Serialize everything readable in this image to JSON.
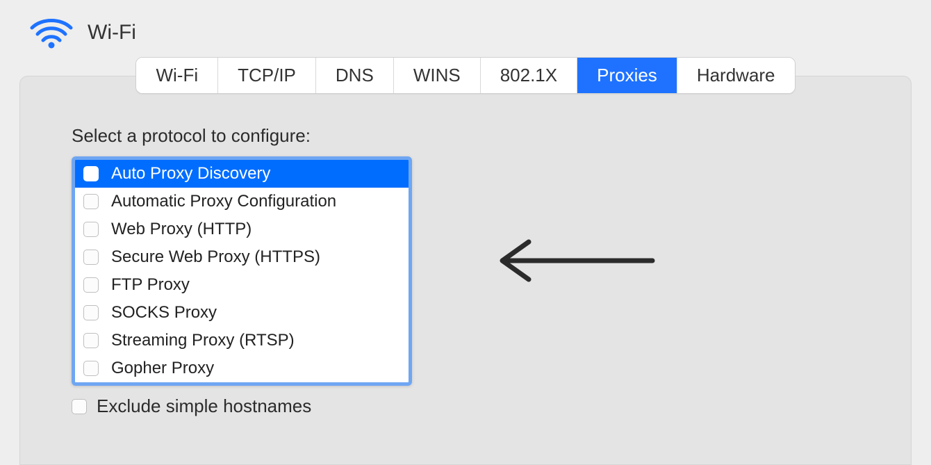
{
  "header": {
    "interface_name": "Wi-Fi"
  },
  "tabs": [
    {
      "label": "Wi-Fi",
      "active": false
    },
    {
      "label": "TCP/IP",
      "active": false
    },
    {
      "label": "DNS",
      "active": false
    },
    {
      "label": "WINS",
      "active": false
    },
    {
      "label": "802.1X",
      "active": false
    },
    {
      "label": "Proxies",
      "active": true
    },
    {
      "label": "Hardware",
      "active": false
    }
  ],
  "proxies": {
    "section_label": "Select a protocol to configure:",
    "protocols": [
      {
        "label": "Auto Proxy Discovery",
        "checked": false,
        "selected": true
      },
      {
        "label": "Automatic Proxy Configuration",
        "checked": false,
        "selected": false
      },
      {
        "label": "Web Proxy (HTTP)",
        "checked": false,
        "selected": false
      },
      {
        "label": "Secure Web Proxy (HTTPS)",
        "checked": false,
        "selected": false
      },
      {
        "label": "FTP Proxy",
        "checked": false,
        "selected": false
      },
      {
        "label": "SOCKS Proxy",
        "checked": false,
        "selected": false
      },
      {
        "label": "Streaming Proxy (RTSP)",
        "checked": false,
        "selected": false
      },
      {
        "label": "Gopher Proxy",
        "checked": false,
        "selected": false
      }
    ],
    "exclude_label": "Exclude simple hostnames",
    "exclude_checked": false
  }
}
